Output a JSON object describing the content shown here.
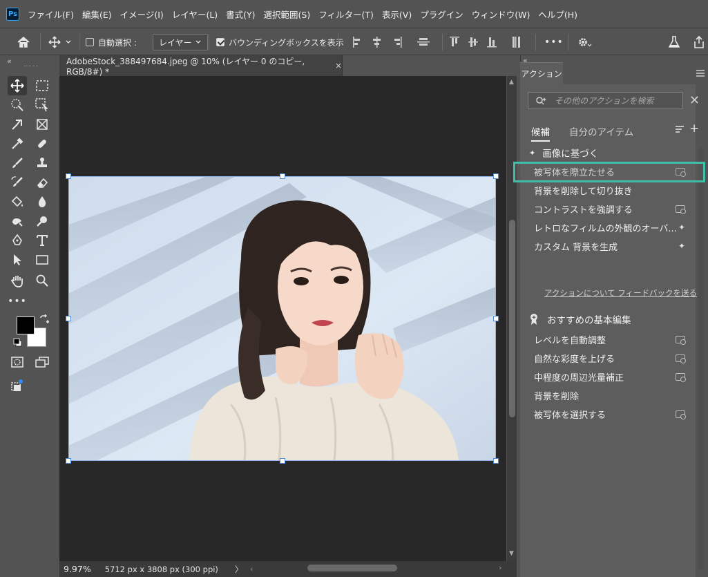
{
  "app": {
    "logo": "Ps"
  },
  "menu": [
    "ファイル(F)",
    "編集(E)",
    "イメージ(I)",
    "レイヤー(L)",
    "書式(Y)",
    "選択範囲(S)",
    "フィルター(T)",
    "表示(V)",
    "プラグイン",
    "ウィンドウ(W)",
    "ヘルプ(H)"
  ],
  "options": {
    "auto_select_label": "自動選択 :",
    "auto_select_value": "レイヤー",
    "bounding_box_label": "バウンディングボックスを表示",
    "more": "•••"
  },
  "document": {
    "tab_title": "AdobeStock_388497684.jpeg @ 10% (レイヤー 0 のコピー, RGB/8#) *",
    "close": "×",
    "zoom": "9.97%",
    "dimensions": "5712 px x 3808 px (300 ppi)",
    "status_arrow": "〉"
  },
  "actions_panel": {
    "tab": "アクション",
    "search_placeholder": "その他のアクションを検索",
    "tabs": [
      "候補",
      "自分のアイテム"
    ],
    "section1": "画像に基づく",
    "suggested": [
      {
        "label": "被写体を際立たせる",
        "icon": "preview-icon"
      },
      {
        "label": "背景を削除して切り抜き",
        "icon": ""
      },
      {
        "label": "コントラストを強調する",
        "icon": "preview-icon"
      },
      {
        "label": "レトロなフィルムの外観のオーバ...",
        "icon": "wand-icon"
      },
      {
        "label": "カスタム 背景を生成",
        "icon": "wand-icon"
      }
    ],
    "feedback": "アクションについて フィードバックを送る",
    "section2": "おすすめの基本編集",
    "basic": [
      {
        "label": "レベルを自動調整",
        "icon": "preview-icon"
      },
      {
        "label": "自然な彩度を上げる",
        "icon": "preview-icon"
      },
      {
        "label": "中程度の周辺光量補正",
        "icon": "preview-icon"
      },
      {
        "label": "背景を削除",
        "icon": ""
      },
      {
        "label": "被写体を選択する",
        "icon": "preview-icon"
      }
    ]
  }
}
